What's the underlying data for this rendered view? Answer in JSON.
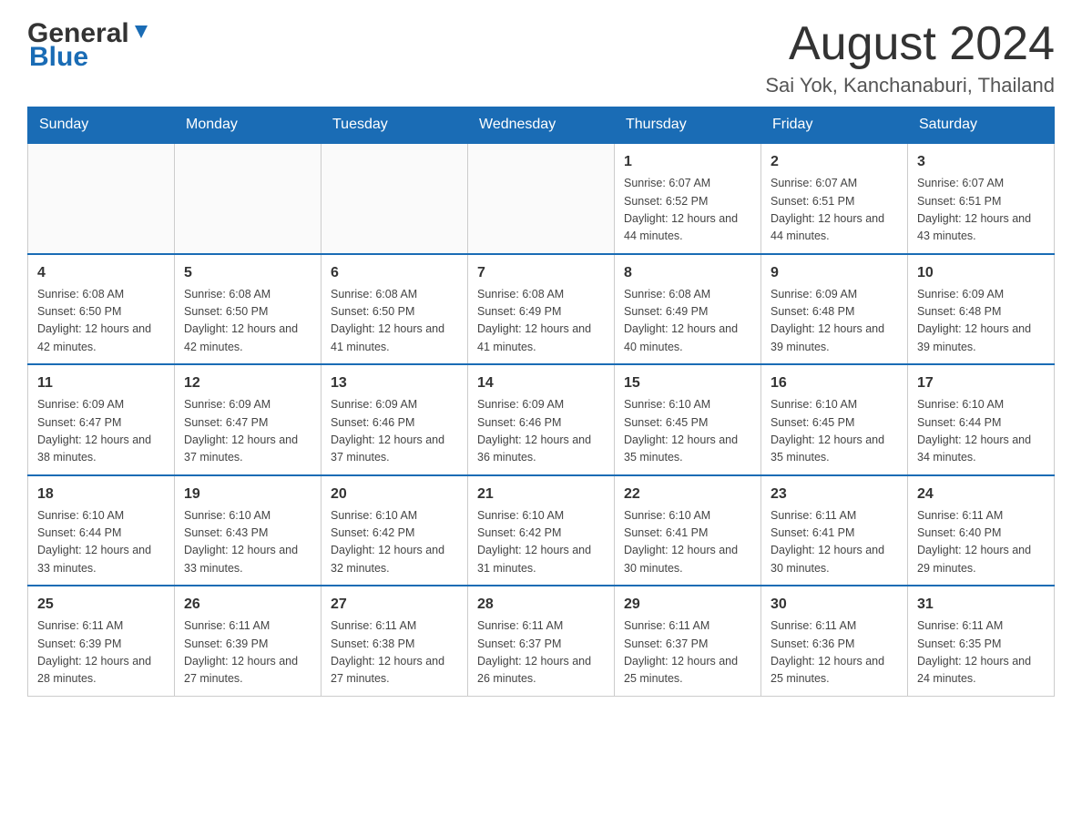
{
  "logo": {
    "text_general": "General",
    "text_blue": "Blue"
  },
  "header": {
    "month_title": "August 2024",
    "location": "Sai Yok, Kanchanaburi, Thailand"
  },
  "days_of_week": [
    "Sunday",
    "Monday",
    "Tuesday",
    "Wednesday",
    "Thursday",
    "Friday",
    "Saturday"
  ],
  "weeks": [
    [
      {
        "day": "",
        "info": ""
      },
      {
        "day": "",
        "info": ""
      },
      {
        "day": "",
        "info": ""
      },
      {
        "day": "",
        "info": ""
      },
      {
        "day": "1",
        "info": "Sunrise: 6:07 AM\nSunset: 6:52 PM\nDaylight: 12 hours and 44 minutes."
      },
      {
        "day": "2",
        "info": "Sunrise: 6:07 AM\nSunset: 6:51 PM\nDaylight: 12 hours and 44 minutes."
      },
      {
        "day": "3",
        "info": "Sunrise: 6:07 AM\nSunset: 6:51 PM\nDaylight: 12 hours and 43 minutes."
      }
    ],
    [
      {
        "day": "4",
        "info": "Sunrise: 6:08 AM\nSunset: 6:50 PM\nDaylight: 12 hours and 42 minutes."
      },
      {
        "day": "5",
        "info": "Sunrise: 6:08 AM\nSunset: 6:50 PM\nDaylight: 12 hours and 42 minutes."
      },
      {
        "day": "6",
        "info": "Sunrise: 6:08 AM\nSunset: 6:50 PM\nDaylight: 12 hours and 41 minutes."
      },
      {
        "day": "7",
        "info": "Sunrise: 6:08 AM\nSunset: 6:49 PM\nDaylight: 12 hours and 41 minutes."
      },
      {
        "day": "8",
        "info": "Sunrise: 6:08 AM\nSunset: 6:49 PM\nDaylight: 12 hours and 40 minutes."
      },
      {
        "day": "9",
        "info": "Sunrise: 6:09 AM\nSunset: 6:48 PM\nDaylight: 12 hours and 39 minutes."
      },
      {
        "day": "10",
        "info": "Sunrise: 6:09 AM\nSunset: 6:48 PM\nDaylight: 12 hours and 39 minutes."
      }
    ],
    [
      {
        "day": "11",
        "info": "Sunrise: 6:09 AM\nSunset: 6:47 PM\nDaylight: 12 hours and 38 minutes."
      },
      {
        "day": "12",
        "info": "Sunrise: 6:09 AM\nSunset: 6:47 PM\nDaylight: 12 hours and 37 minutes."
      },
      {
        "day": "13",
        "info": "Sunrise: 6:09 AM\nSunset: 6:46 PM\nDaylight: 12 hours and 37 minutes."
      },
      {
        "day": "14",
        "info": "Sunrise: 6:09 AM\nSunset: 6:46 PM\nDaylight: 12 hours and 36 minutes."
      },
      {
        "day": "15",
        "info": "Sunrise: 6:10 AM\nSunset: 6:45 PM\nDaylight: 12 hours and 35 minutes."
      },
      {
        "day": "16",
        "info": "Sunrise: 6:10 AM\nSunset: 6:45 PM\nDaylight: 12 hours and 35 minutes."
      },
      {
        "day": "17",
        "info": "Sunrise: 6:10 AM\nSunset: 6:44 PM\nDaylight: 12 hours and 34 minutes."
      }
    ],
    [
      {
        "day": "18",
        "info": "Sunrise: 6:10 AM\nSunset: 6:44 PM\nDaylight: 12 hours and 33 minutes."
      },
      {
        "day": "19",
        "info": "Sunrise: 6:10 AM\nSunset: 6:43 PM\nDaylight: 12 hours and 33 minutes."
      },
      {
        "day": "20",
        "info": "Sunrise: 6:10 AM\nSunset: 6:42 PM\nDaylight: 12 hours and 32 minutes."
      },
      {
        "day": "21",
        "info": "Sunrise: 6:10 AM\nSunset: 6:42 PM\nDaylight: 12 hours and 31 minutes."
      },
      {
        "day": "22",
        "info": "Sunrise: 6:10 AM\nSunset: 6:41 PM\nDaylight: 12 hours and 30 minutes."
      },
      {
        "day": "23",
        "info": "Sunrise: 6:11 AM\nSunset: 6:41 PM\nDaylight: 12 hours and 30 minutes."
      },
      {
        "day": "24",
        "info": "Sunrise: 6:11 AM\nSunset: 6:40 PM\nDaylight: 12 hours and 29 minutes."
      }
    ],
    [
      {
        "day": "25",
        "info": "Sunrise: 6:11 AM\nSunset: 6:39 PM\nDaylight: 12 hours and 28 minutes."
      },
      {
        "day": "26",
        "info": "Sunrise: 6:11 AM\nSunset: 6:39 PM\nDaylight: 12 hours and 27 minutes."
      },
      {
        "day": "27",
        "info": "Sunrise: 6:11 AM\nSunset: 6:38 PM\nDaylight: 12 hours and 27 minutes."
      },
      {
        "day": "28",
        "info": "Sunrise: 6:11 AM\nSunset: 6:37 PM\nDaylight: 12 hours and 26 minutes."
      },
      {
        "day": "29",
        "info": "Sunrise: 6:11 AM\nSunset: 6:37 PM\nDaylight: 12 hours and 25 minutes."
      },
      {
        "day": "30",
        "info": "Sunrise: 6:11 AM\nSunset: 6:36 PM\nDaylight: 12 hours and 25 minutes."
      },
      {
        "day": "31",
        "info": "Sunrise: 6:11 AM\nSunset: 6:35 PM\nDaylight: 12 hours and 24 minutes."
      }
    ]
  ]
}
